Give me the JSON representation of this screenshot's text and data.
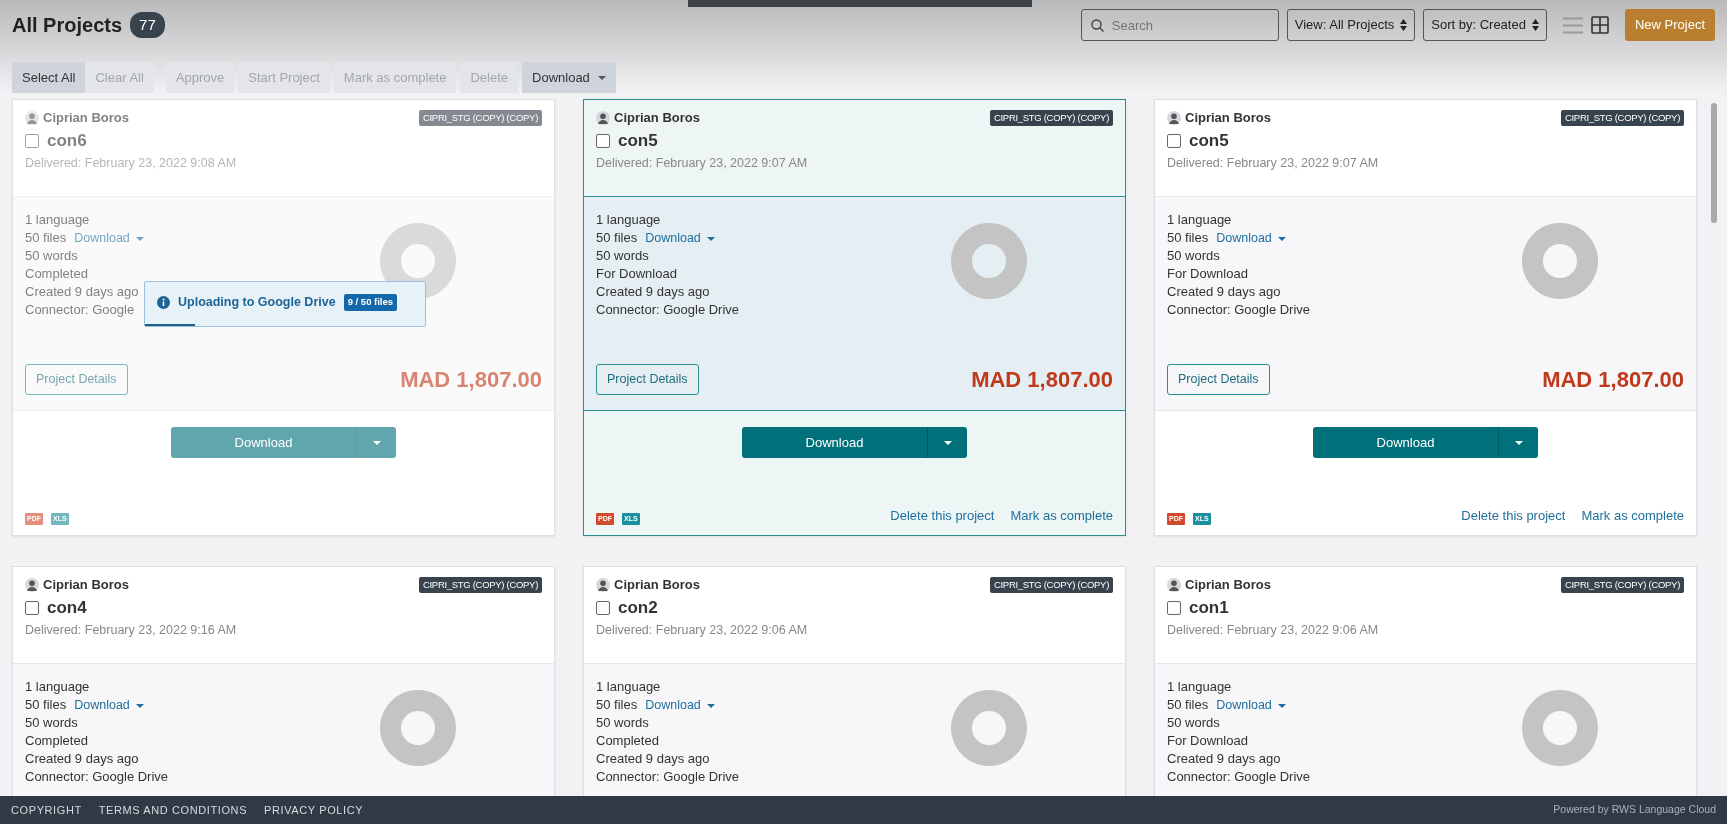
{
  "page": {
    "title": "All Projects",
    "count": "77"
  },
  "selection_buttons": [
    {
      "label": "Select All",
      "disabled": false
    },
    {
      "label": "Clear All",
      "disabled": true
    }
  ],
  "action_buttons": [
    {
      "label": "Approve",
      "kind": "button",
      "disabled": true
    },
    {
      "label": "Start Project",
      "kind": "button",
      "disabled": true
    },
    {
      "label": "Mark as complete",
      "kind": "button",
      "disabled": true
    },
    {
      "label": "Delete",
      "kind": "button",
      "disabled": true
    },
    {
      "label": "Download",
      "kind": "dropdown",
      "disabled": false
    }
  ],
  "search": {
    "placeholder": "Search"
  },
  "view_select": "View: All Projects",
  "sort_select": "Sort by: Created",
  "view_modes": [
    {
      "kind": "list",
      "selected": false
    },
    {
      "kind": "grid",
      "selected": true
    }
  ],
  "new_project": "New Project",
  "projects": [
    {
      "owner": "Ciprian Boros",
      "tag": "CIPRI_STG (COPY) (COPY)",
      "name": "con6",
      "checked": false,
      "selected": false,
      "faded": true,
      "delivered": "Delivered: February 23, 2022 9:08 AM",
      "languages": "1 language",
      "files": "50 files",
      "files_link": "Download",
      "words": "50 words",
      "status": "Completed",
      "created": "Created 9 days ago",
      "connector": "Connector: Google",
      "details_button": "Project Details",
      "price": "MAD 1,807.00",
      "download_button": "Download",
      "file_icons": [
        {
          "kind": "pdf",
          "label": "PDF"
        },
        {
          "kind": "xls",
          "label": "XLS"
        }
      ],
      "upload": {
        "message": "Uploading to Google Drive",
        "badge": "9 / 50 files",
        "level": 0.18
      }
    },
    {
      "owner": "Ciprian Boros",
      "tag": "CIPRI_STG (COPY) (COPY)",
      "name": "con5",
      "checked": false,
      "selected": true,
      "faded": false,
      "delivered": "Delivered: February 23, 2022 9:07 AM",
      "languages": "1 language",
      "files": "50 files",
      "files_link": "Download",
      "words": "50 words",
      "status": "For Download",
      "created": "Created 9 days ago",
      "connector": "Connector: Google Drive",
      "details_button": "Project Details",
      "price": "MAD 1,807.00",
      "download_button": "Download",
      "file_icons": [
        {
          "kind": "pdf",
          "label": "PDF"
        },
        {
          "kind": "xls",
          "label": "XLS"
        }
      ],
      "links": [
        "Delete this project",
        "Mark as complete"
      ]
    },
    {
      "owner": "Ciprian Boros",
      "tag": "CIPRI_STG (COPY) (COPY)",
      "name": "con5",
      "checked": false,
      "selected": false,
      "faded": false,
      "delivered": "Delivered: February 23, 2022 9:07 AM",
      "languages": "1 language",
      "files": "50 files",
      "files_link": "Download",
      "words": "50 words",
      "status": "For Download",
      "created": "Created 9 days ago",
      "connector": "Connector: Google Drive",
      "details_button": "Project Details",
      "price": "MAD 1,807.00",
      "download_button": "Download",
      "file_icons": [
        {
          "kind": "pdf",
          "label": "PDF"
        },
        {
          "kind": "xls",
          "label": "XLS"
        }
      ],
      "links": [
        "Delete this project",
        "Mark as complete"
      ]
    },
    {
      "owner": "Ciprian Boros",
      "tag": "CIPRI_STG (COPY) (COPY)",
      "name": "con4",
      "checked": false,
      "selected": false,
      "faded": false,
      "delivered": "Delivered: February 23, 2022 9:16 AM",
      "languages": "1 language",
      "files": "50 files",
      "files_link": "Download",
      "words": "50 words",
      "status": "Completed",
      "created": "Created 9 days ago",
      "connector": "Connector: Google Drive"
    },
    {
      "owner": "Ciprian Boros",
      "tag": "CIPRI_STG (COPY) (COPY)",
      "name": "con2",
      "checked": false,
      "selected": false,
      "faded": false,
      "delivered": "Delivered: February 23, 2022 9:06 AM",
      "languages": "1 language",
      "files": "50 files",
      "files_link": "Download",
      "words": "50 words",
      "status": "Completed",
      "created": "Created 9 days ago",
      "connector": "Connector: Google Drive"
    },
    {
      "owner": "Ciprian Boros",
      "tag": "CIPRI_STG (COPY) (COPY)",
      "name": "con1",
      "checked": false,
      "selected": false,
      "faded": false,
      "delivered": "Delivered: February 23, 2022 9:06 AM",
      "languages": "1 language",
      "files": "50 files",
      "files_link": "Download",
      "words": "50 words",
      "status": "For Download",
      "created": "Created 9 days ago",
      "connector": "Connector: Google Drive"
    }
  ],
  "footer": {
    "links": [
      "COPYRIGHT",
      "TERMS AND CONDITIONS",
      "PRIVACY POLICY"
    ],
    "powered_by": "Powered by RWS Language Cloud"
  }
}
